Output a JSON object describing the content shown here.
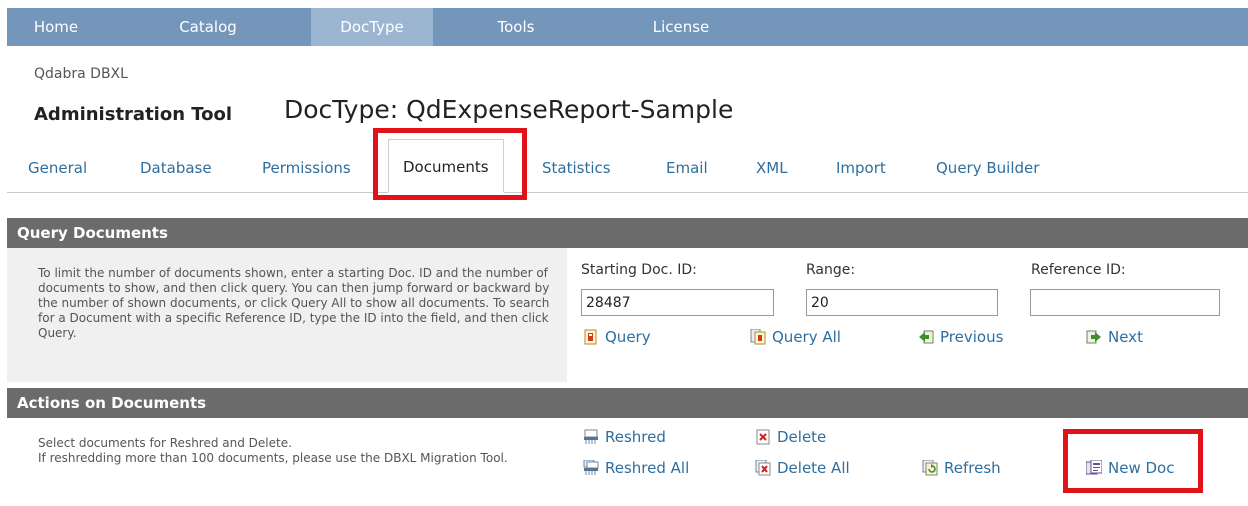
{
  "topnav": {
    "items": [
      {
        "label": "Home"
      },
      {
        "label": "Catalog"
      },
      {
        "label": "DocType"
      },
      {
        "label": "Tools"
      },
      {
        "label": "License"
      }
    ]
  },
  "header": {
    "brand_small": "Qdabra DBXL",
    "brand_big": "Administration Tool",
    "doctype_title": "DocType: QdExpenseReport-Sample"
  },
  "tabs": [
    {
      "label": "General"
    },
    {
      "label": "Database"
    },
    {
      "label": "Permissions"
    },
    {
      "label": "Documents"
    },
    {
      "label": "Statistics"
    },
    {
      "label": "Email"
    },
    {
      "label": "XML"
    },
    {
      "label": "Import"
    },
    {
      "label": "Query Builder"
    }
  ],
  "query_section": {
    "title": "Query Documents",
    "description": "To limit the number of documents shown, enter a starting Doc. ID and the number of documents to show, and then click query. You can then jump forward or backward by the number of shown documents, or click Query All to show all documents. To search for a Document with a specific Reference ID, type the ID into the field, and then click Query.",
    "starting_label": "Starting Doc. ID:",
    "starting_value": "28487",
    "range_label": "Range:",
    "range_value": "20",
    "reference_label": "Reference ID:",
    "reference_value": "",
    "query_label": "Query",
    "query_all_label": "Query All",
    "previous_label": "Previous",
    "next_label": "Next"
  },
  "actions_section": {
    "title": "Actions on Documents",
    "description_line1": "Select documents for Reshred and Delete.",
    "description_line2": "If reshredding more than 100 documents, please use the DBXL Migration Tool.",
    "reshred_label": "Reshred",
    "delete_label": "Delete",
    "reshred_all_label": "Reshred All",
    "delete_all_label": "Delete All",
    "refresh_label": "Refresh",
    "new_doc_label": "New Doc"
  },
  "colors": {
    "nav_bg": "#7596bb",
    "nav_active": "#9cb5d1",
    "link": "#2e6e9e",
    "section_header": "#6b6b6b",
    "highlight": "#e2121b"
  }
}
